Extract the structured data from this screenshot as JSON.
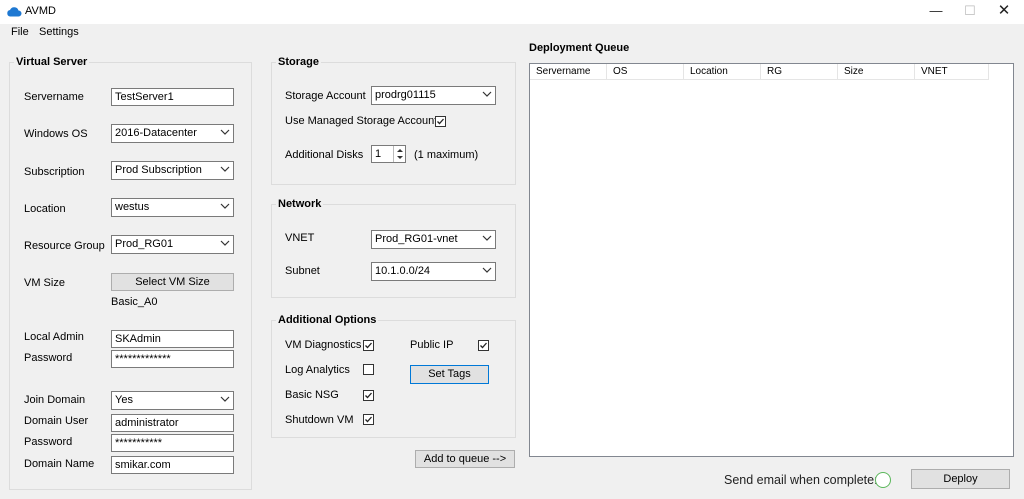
{
  "window": {
    "title": "AVMD",
    "minimize": "—",
    "maximize": "☐",
    "close": "✕",
    "accent_color": "#1e78d2"
  },
  "menu": {
    "file": "File",
    "settings": "Settings"
  },
  "virtual_server": {
    "title": "Virtual Server",
    "servername_label": "Servername",
    "servername_value": "TestServer1",
    "os_label": "Windows OS",
    "os_value": "2016-Datacenter",
    "subscription_label": "Subscription",
    "subscription_value": "Prod Subscription",
    "location_label": "Location",
    "location_value": "westus",
    "rg_label": "Resource Group",
    "rg_value": "Prod_RG01",
    "vmsize_label": "VM Size",
    "vmsize_button": "Select VM Size",
    "vmsize_value": "Basic_A0",
    "admin_label": "Local Admin",
    "admin_value": "SKAdmin",
    "password_label": "Password",
    "password_value": "*************",
    "join_domain_label": "Join Domain",
    "join_domain_value": "Yes",
    "domain_user_label": "Domain User",
    "domain_user_value": "administrator",
    "domain_password_label": "Password",
    "domain_password_value": "***********",
    "domain_name_label": "Domain Name",
    "domain_name_value": "smikar.com"
  },
  "storage": {
    "title": "Storage",
    "account_label": "Storage Account",
    "account_value": "prodrg01115",
    "managed_label": "Use Managed Storage Account",
    "managed_checked": true,
    "disks_label": "Additional Disks",
    "disks_value": "1",
    "disks_note": "(1 maximum)"
  },
  "network": {
    "title": "Network",
    "vnet_label": "VNET",
    "vnet_value": "Prod_RG01-vnet",
    "subnet_label": "Subnet",
    "subnet_value": "10.1.0.0/24"
  },
  "options": {
    "title": "Additional Options",
    "vm_diag_label": "VM Diagnostics",
    "vm_diag_checked": true,
    "public_ip_label": "Public IP",
    "public_ip_checked": true,
    "log_analytics_label": "Log Analytics",
    "log_analytics_checked": false,
    "set_tags_button": "Set Tags",
    "basic_nsg_label": "Basic NSG",
    "basic_nsg_checked": true,
    "shutdown_label": "Shutdown VM",
    "shutdown_checked": true
  },
  "add_queue_button": "Add to queue -->",
  "queue": {
    "title": "Deployment Queue",
    "columns": [
      "Servername",
      "OS",
      "Location",
      "RG",
      "Size",
      "VNET"
    ]
  },
  "email_label": "Send email when complete:",
  "email_selected": false,
  "email_radio_color": "#5cb85c",
  "deploy_button": "Deploy"
}
